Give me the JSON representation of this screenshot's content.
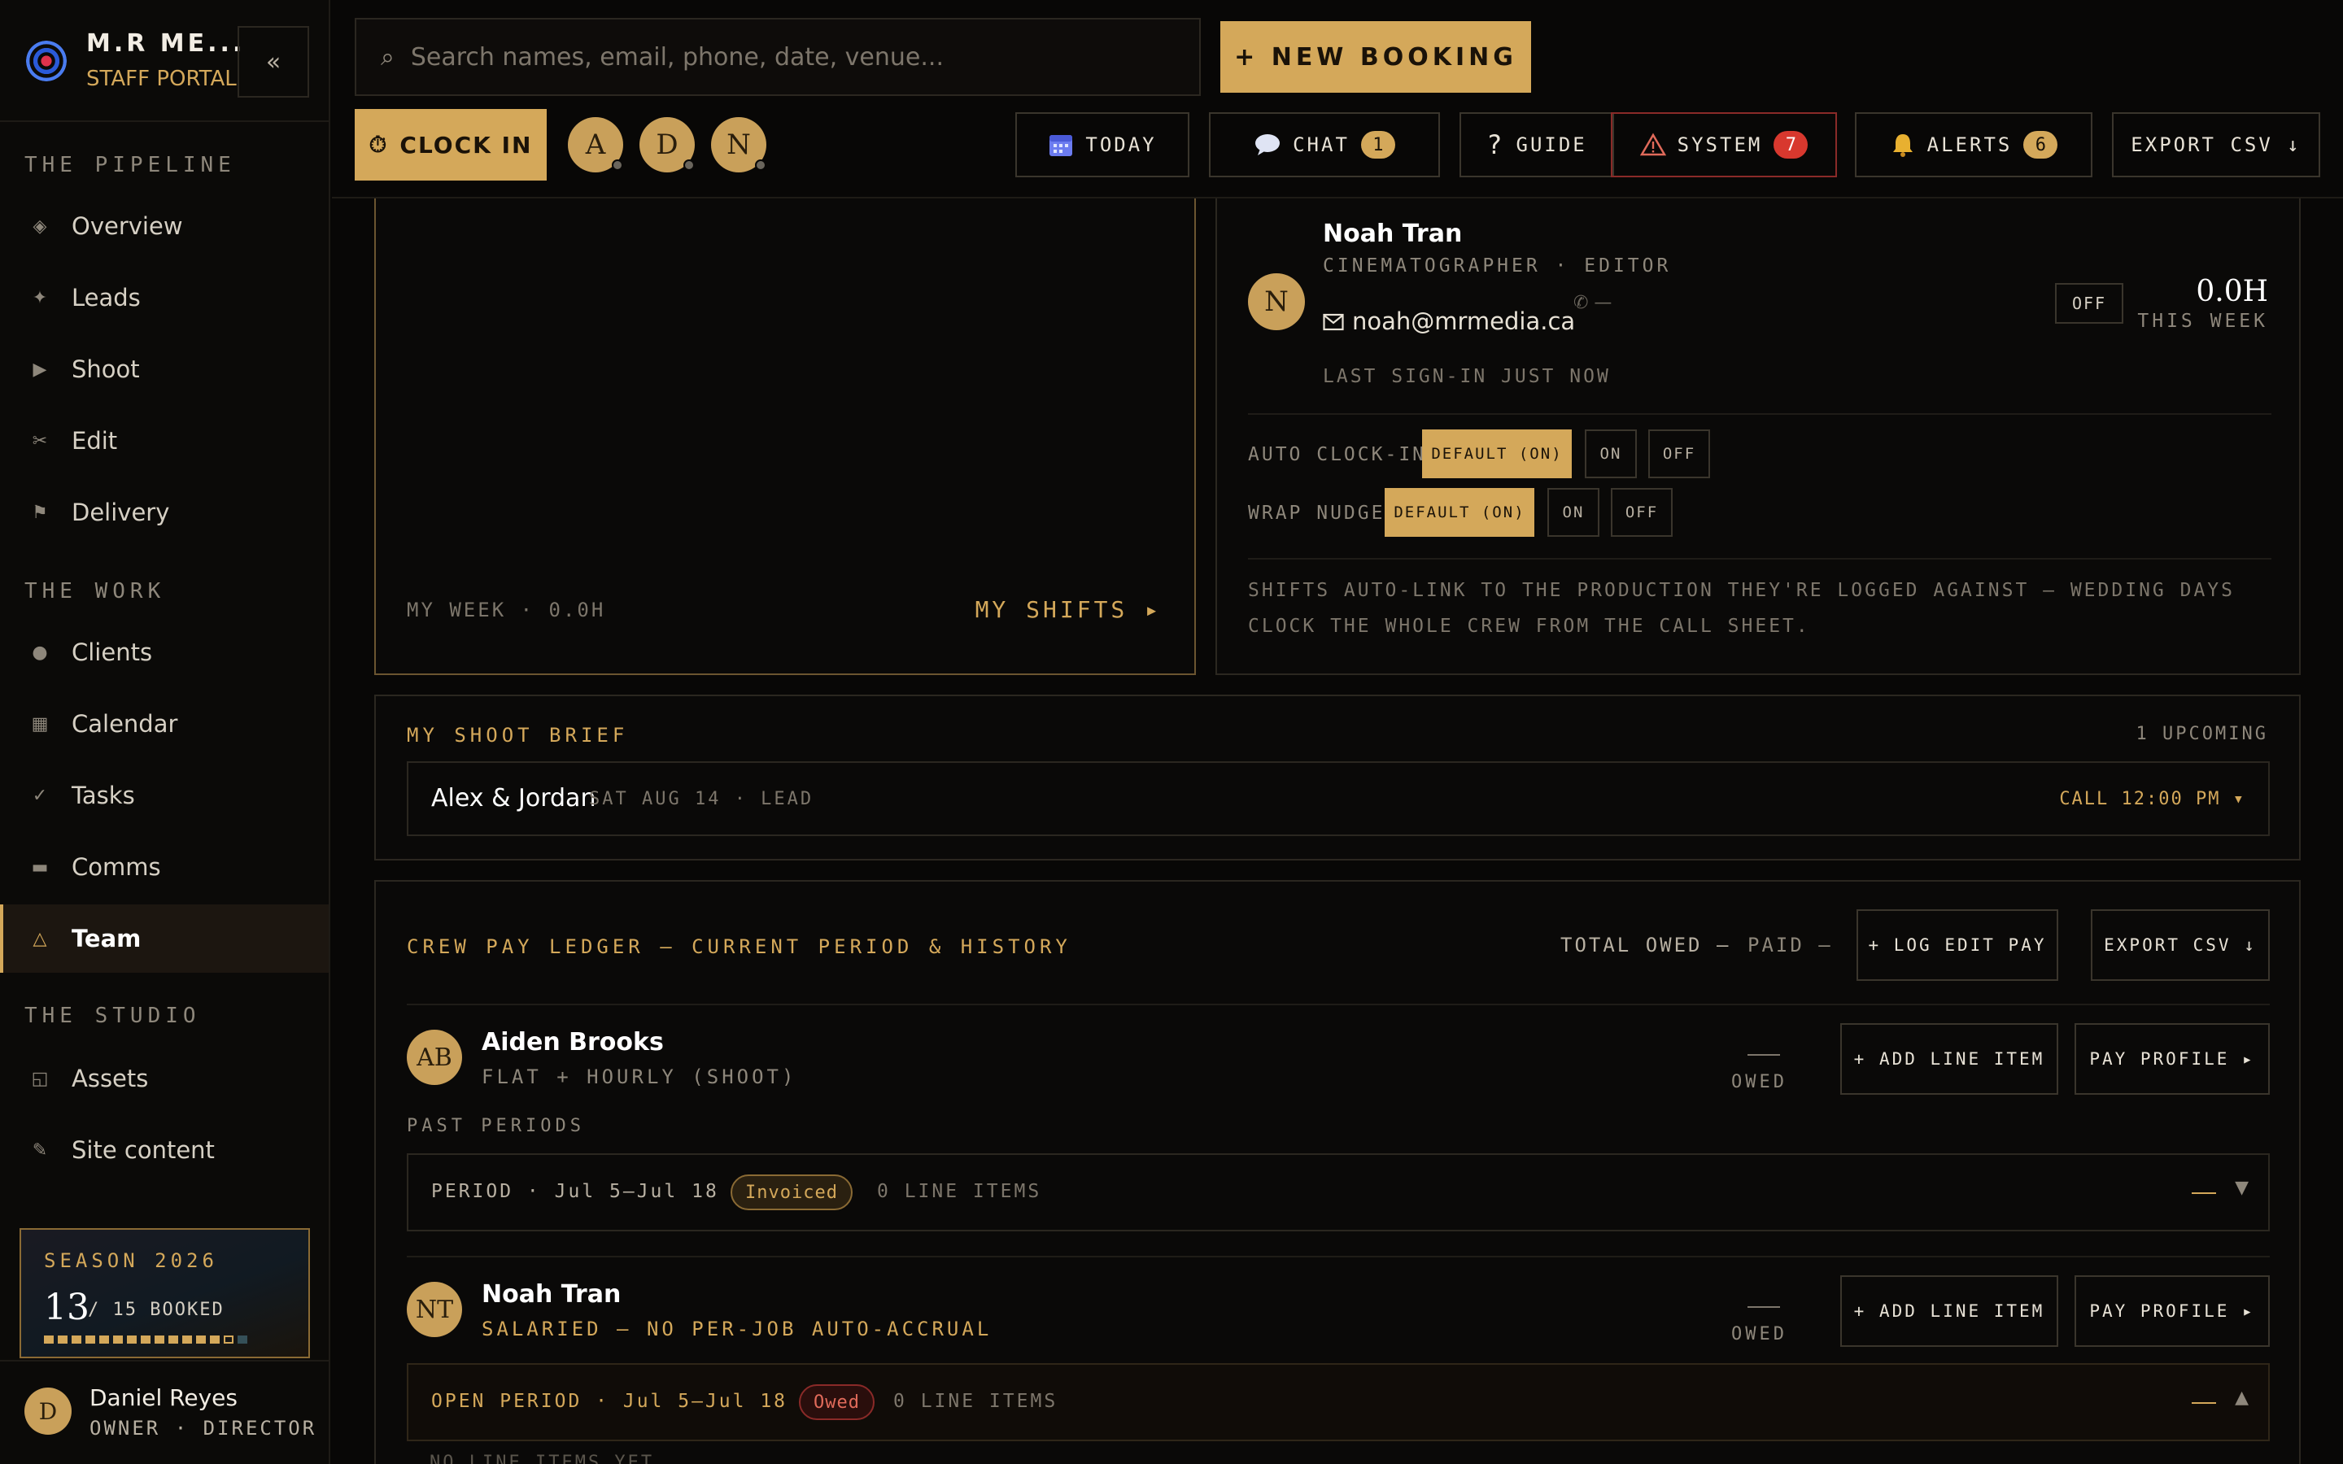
{
  "brand": {
    "name": "M.R ME...",
    "subtitle": "STAFF PORTAL",
    "collapse": "«"
  },
  "sidebar": {
    "sections": [
      {
        "title": "THE PIPELINE",
        "items": [
          {
            "label": "Overview",
            "icon": "◈"
          },
          {
            "label": "Leads",
            "icon": "✦"
          },
          {
            "label": "Shoot",
            "icon": "▶"
          },
          {
            "label": "Edit",
            "icon": "✂"
          },
          {
            "label": "Delivery",
            "icon": "⚑"
          }
        ]
      },
      {
        "title": "THE WORK",
        "items": [
          {
            "label": "Clients",
            "icon": "●"
          },
          {
            "label": "Calendar",
            "icon": "▦"
          },
          {
            "label": "Tasks",
            "icon": "✓"
          },
          {
            "label": "Comms",
            "icon": "▬"
          },
          {
            "label": "Team",
            "icon": "△",
            "active": true
          }
        ]
      },
      {
        "title": "THE STUDIO",
        "items": [
          {
            "label": "Assets",
            "icon": "◱"
          },
          {
            "label": "Site content",
            "icon": "✎"
          }
        ]
      }
    ],
    "season": {
      "title": "SEASON 2026",
      "booked": "13",
      "total": "/ 15 BOOKED",
      "booked_count": 13,
      "total_count": 15
    },
    "user": {
      "initial": "D",
      "name": "Daniel Reyes",
      "role": "OWNER · DIRECTOR"
    }
  },
  "topbar": {
    "search_placeholder": "Search names, email, phone, date, venue...",
    "search_icon": "⌕",
    "new_booking": "+ NEW BOOKING",
    "clock_in": "CLOCK IN",
    "clock_icon": "⏱",
    "crew": [
      "A",
      "D",
      "N"
    ],
    "buttons": {
      "today": "TODAY",
      "chat": "CHAT",
      "chat_count": "1",
      "guide": "GUIDE",
      "guide_icon": "?",
      "system": "SYSTEM",
      "system_count": "7",
      "alerts": "ALERTS",
      "alerts_count": "6",
      "export": "EXPORT CSV ↓"
    }
  },
  "my_week": {
    "label": "MY WEEK · 0.0H",
    "link": "MY SHIFTS ▸"
  },
  "profile": {
    "initial": "N",
    "name": "Noah Tran",
    "role": "CINEMATOGRAPHER · EDITOR",
    "email": "noah@mrmedia.ca",
    "phone": "✆ —",
    "last_signin": "LAST SIGN-IN JUST NOW",
    "status": "OFF",
    "hours": "0.0H",
    "hours_label": "THIS WEEK",
    "auto_clock_label": "AUTO CLOCK-IN",
    "wrap_nudge_label": "WRAP NUDGE",
    "opt_default": "DEFAULT (ON)",
    "opt_on": "ON",
    "opt_off": "OFF",
    "note": "SHIFTS AUTO-LINK TO THE PRODUCTION THEY'RE LOGGED AGAINST — WEDDING DAYS CLOCK THE WHOLE CREW FROM THE CALL SHEET."
  },
  "brief": {
    "title": "MY SHOOT BRIEF",
    "upcoming": "1 UPCOMING",
    "couple": "Alex & Jordan",
    "meta": "SAT AUG 14 · LEAD",
    "call": "CALL 12:00 PM ▾"
  },
  "ledger": {
    "title": "CREW PAY LEDGER — CURRENT PERIOD & HISTORY",
    "total_owed": "TOTAL OWED —",
    "paid": "PAID —",
    "log_edit_pay": "+ LOG EDIT PAY",
    "export": "EXPORT CSV ↓",
    "add_line_item": "+ ADD LINE ITEM",
    "pay_profile": "PAY PROFILE ▸",
    "owed_label": "OWED",
    "past_periods": "PAST PERIODS",
    "members": [
      {
        "initials": "AB",
        "name": "Aiden Brooks",
        "type": "FLAT + HOURLY (SHOOT)",
        "period": "PERIOD · Jul 5–Jul 18",
        "status": "Invoiced",
        "count": "0 LINE ITEMS"
      },
      {
        "initials": "NT",
        "name": "Noah Tran",
        "type": "SALARIED — NO PER-JOB AUTO-ACCRUAL",
        "period": "OPEN PERIOD · Jul 5–Jul 18",
        "status": "Owed",
        "count": "0 LINE ITEMS"
      }
    ],
    "no_items": "NO LINE ITEMS YET"
  }
}
